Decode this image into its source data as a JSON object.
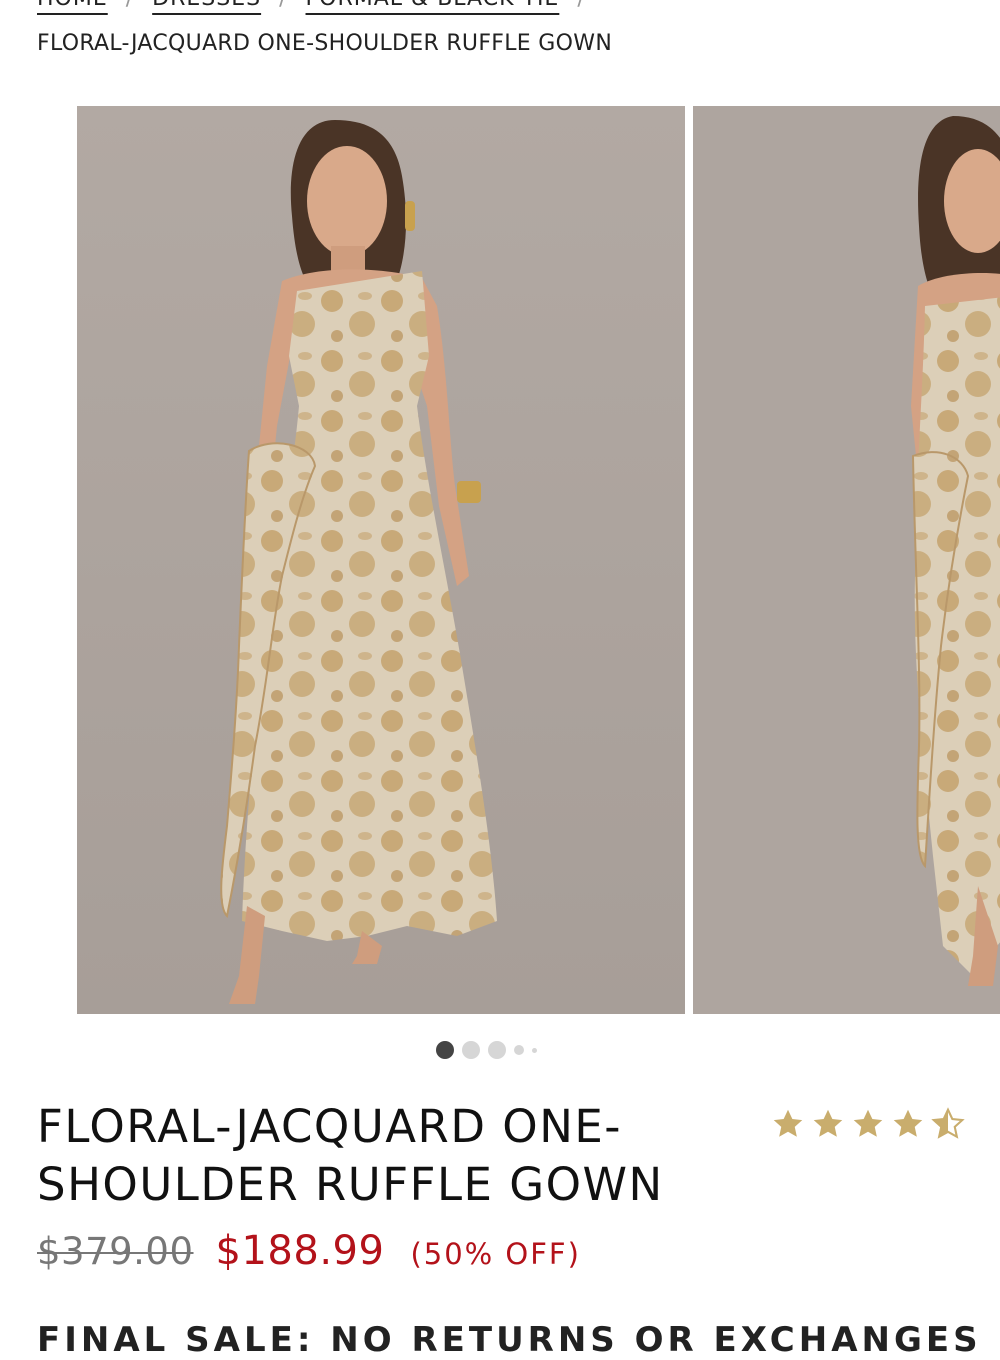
{
  "breadcrumb": {
    "items": [
      "HOME",
      "DRESSES",
      "FORMAL & BLACK TIE"
    ],
    "separator": "/",
    "current": "FLORAL-JACQUARD ONE-SHOULDER RUFFLE GOWN"
  },
  "gallery": {
    "image_count": 5,
    "active_index": 0,
    "background_color": "#aea59f",
    "dress_color": "#d9cbb2",
    "floral_color": "#c2a06a"
  },
  "product": {
    "title": "FLORAL-JACQUARD ONE-SHOULDER RUFFLE GOWN",
    "rating": 4.5,
    "rating_max": 5,
    "star_color": "#c9ad6d"
  },
  "pricing": {
    "original": "$379.00",
    "sale": "$188.99",
    "discount": "(50% OFF)",
    "sale_color": "#b3121a"
  },
  "notice": "FINAL SALE: NO RETURNS OR EXCHANGES"
}
